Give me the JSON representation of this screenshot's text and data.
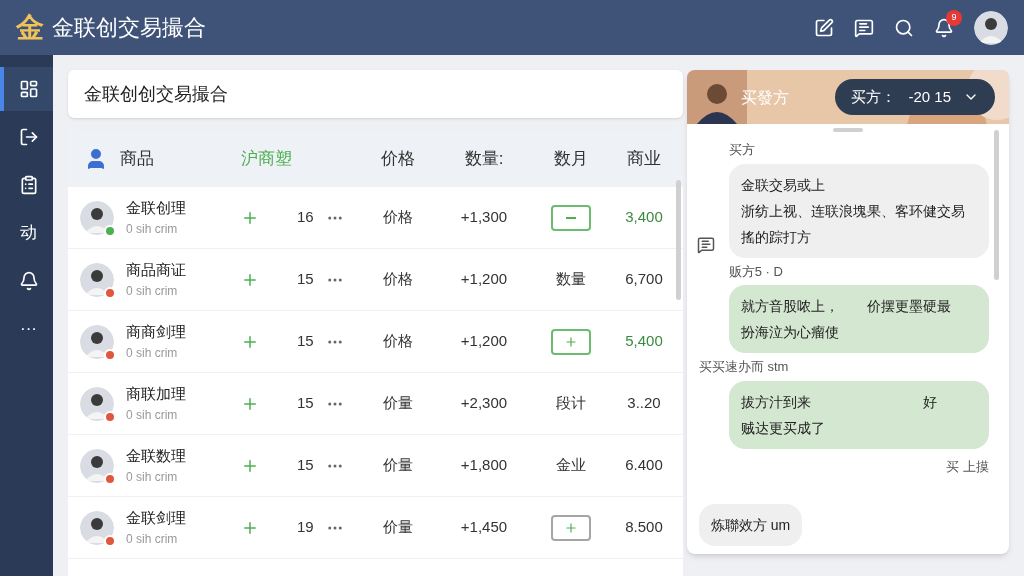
{
  "app": {
    "logo": "金",
    "title": "金联创交易撮合",
    "notification_badge": "9"
  },
  "sidebar": {
    "items": [
      {
        "selected": true
      },
      {
        "selected": false
      },
      {
        "selected": false
      },
      {
        "label": "动",
        "selected": false
      },
      {
        "selected": false
      },
      {
        "label": "···",
        "selected": false
      }
    ]
  },
  "page_title": "金联创创交易撮合",
  "table": {
    "columns": [
      {
        "label": "商品",
        "highlighted": false
      },
      {
        "label": "沪商塑",
        "highlighted": true
      },
      {
        "label": "价格",
        "highlighted": false
      },
      {
        "label": "数量:",
        "highlighted": false
      },
      {
        "label": "数月",
        "highlighted": false
      },
      {
        "label": "商业",
        "highlighted": false
      }
    ],
    "rows": [
      {
        "name": "金联创理",
        "subtitle": "0 sih crim",
        "color": "#4caf50",
        "count": "16",
        "price": "价格",
        "quantity": "+1,300",
        "month": {
          "kind": "minus",
          "highlighted": true
        },
        "value": "3,400",
        "value_green": true
      },
      {
        "name": "商品商证",
        "subtitle": "0 sih crim",
        "color": "#e2553f",
        "count": "15",
        "price": "价格",
        "quantity": "+1,200",
        "month": {
          "kind": "text",
          "label": "数量"
        },
        "value": "6,700",
        "value_green": false
      },
      {
        "name": "商商剑理",
        "subtitle": "0 sih crim",
        "color": "#e2553f",
        "count": "15",
        "price": "价格",
        "quantity": "+1,200",
        "month": {
          "kind": "plus",
          "highlighted": true
        },
        "value": "5,400",
        "value_green": true
      },
      {
        "name": "商联加理",
        "subtitle": "0 sih crim",
        "color": "#e2553f",
        "count": "15",
        "price": "价量",
        "quantity": "+2,300",
        "month": {
          "kind": "text",
          "label": "段计"
        },
        "value": "3..20",
        "value_green": false
      },
      {
        "name": "金联数理",
        "subtitle": "0 sih crim",
        "color": "#e2553f",
        "count": "15",
        "price": "价量",
        "quantity": "+1,800",
        "month": {
          "kind": "text",
          "label": "金业"
        },
        "value": "6.400",
        "value_green": false
      },
      {
        "name": "金联剑理",
        "subtitle": "0 sih crim",
        "color": "#e2553f",
        "count": "19",
        "price": "价量",
        "quantity": "+1,450",
        "month": {
          "kind": "plus",
          "highlighted": false
        },
        "value": "8.500",
        "value_green": false
      }
    ]
  },
  "chat": {
    "header_label": "买發方",
    "dropdown_label": "买方：",
    "dropdown_value": "-20 15",
    "messages": [
      {
        "sender": "买方",
        "kind": "incoming",
        "lines": [
          "金联交易或上",
          "浙纺上视、连联浪塊果、客环健交易",
          "搖的踪打方"
        ]
      },
      {
        "sender": "贩方5 · D",
        "kind": "outgoing",
        "lines": [
          "就方音股哝上，　　价摆更墨硬最",
          "扮海泣为心瘤使"
        ]
      },
      {
        "sender": "买买速办而 stm",
        "kind": "outgoing",
        "lines": [
          "拔方汁到来　　　　　　　　好",
          "贼达更买成了"
        ]
      },
      {
        "sender": "买 上摸",
        "kind": "note"
      },
      {
        "kind": "incoming-small",
        "lines": [
          "炼聯效方 um"
        ]
      }
    ]
  }
}
